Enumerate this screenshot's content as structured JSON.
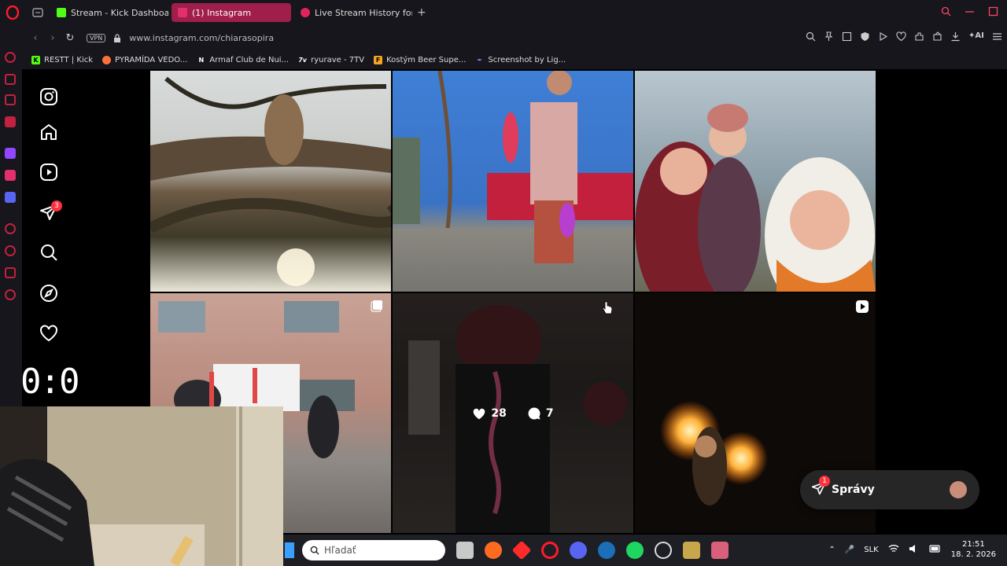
{
  "browser": {
    "tabs": [
      {
        "label": "Stream - Kick Dashboard",
        "active": false,
        "favicon_color": "#53fc18"
      },
      {
        "label": "(1) Instagram",
        "active": true,
        "favicon_color": "#e1306c"
      },
      {
        "label": "Live Stream History for Blе",
        "active": false,
        "favicon_color": "#e0245e"
      }
    ],
    "vpn_label": "VPN",
    "url": "www.instagram.com/chiarasopira",
    "bookmarks": [
      {
        "label": "RESTT | Kick",
        "icon": "K",
        "color": "#53fc18"
      },
      {
        "label": "PYRAMÍDA VEDO...",
        "icon": "firefox",
        "color": "#ff7139"
      },
      {
        "label": "Armaf Club de Nui...",
        "icon": "N",
        "color": "#ffffff"
      },
      {
        "label": "ryurave - 7TV",
        "icon": "7v",
        "color": "#ffffff"
      },
      {
        "label": "Kostým Beer Supe...",
        "icon": "F",
        "color": "#f5a623"
      },
      {
        "label": "Screenshot by Lig...",
        "icon": "feather",
        "color": "#a970ff"
      }
    ]
  },
  "instagram": {
    "notification_count": "3",
    "hover_stats": {
      "likes": "28",
      "comments": "7"
    },
    "messages_label": "Správy",
    "messages_badge": "1"
  },
  "overlay_score": "0:0",
  "taskbar": {
    "search_placeholder": "Hľadať",
    "language": "SLK",
    "time": "21:51",
    "date": "18. 2. 2026"
  }
}
